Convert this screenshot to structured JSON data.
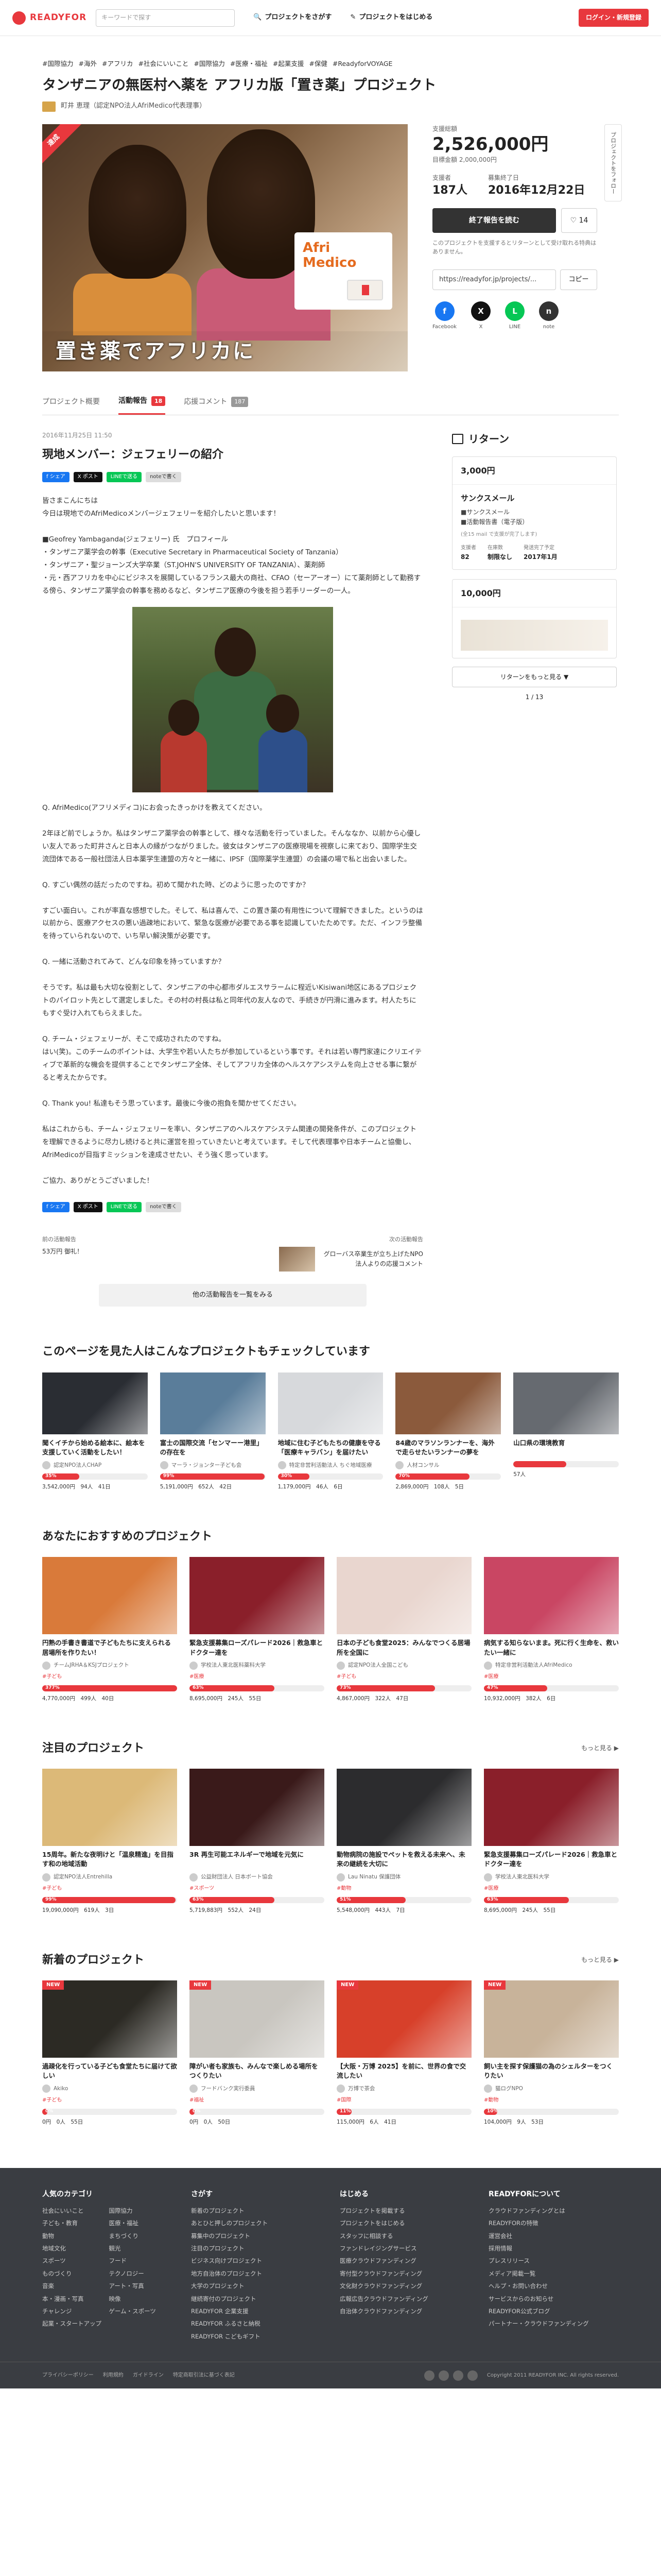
{
  "header": {
    "logo": "READYFOR",
    "search_placeholder": "キーワードで探す",
    "nav_search": "プロジェクトをさがす",
    "nav_start": "プロジェクトをはじめる",
    "login": "ログイン・新規登録"
  },
  "project": {
    "tags": [
      "#国際協力",
      "#海外",
      "#アフリカ",
      "#社会にいいこと",
      "#国際協力",
      "#医療・福祉",
      "#起業支援",
      "#保健",
      "#ReadyforVOYAGE"
    ],
    "title": "タンザニアの無医村へ薬を アフリカ版「置き薬」プロジェクト",
    "owner": "町井 恵理（認定NPO法人AfriMedico代表理事）",
    "hero_ribbon": "達成",
    "hero_brand_a": "Afri",
    "hero_brand_b": "Medico",
    "hero_caption": "置き薬でアフリカに"
  },
  "sidebar": {
    "total_label": "支援総額",
    "total_amount": "2,526,000円",
    "target": "目標金額 2,000,000円",
    "supporters_label": "支援者",
    "supporters": "187人",
    "end_label": "募集終了日",
    "end_date": "2016年12月22日",
    "report_button": "終了報告を読む",
    "favorite_count": "14",
    "note": "このプロジェクトを支援するとリターンとして受け取れる特典はありません。",
    "url": "https://readyfor.jp/projects/...",
    "copy": "コピー",
    "shares": [
      {
        "label": "Facebook",
        "glyph": "f",
        "color": "#1877f2"
      },
      {
        "label": "X",
        "glyph": "X",
        "color": "#111111"
      },
      {
        "label": "LINE",
        "glyph": "L",
        "color": "#06c755"
      },
      {
        "label": "note",
        "glyph": "n",
        "color": "#333333"
      }
    ],
    "follow": "プロジェクトをフォロー"
  },
  "tabs": [
    {
      "label": "プロジェクト概要",
      "badge": ""
    },
    {
      "label": "活動報告",
      "badge": "18"
    },
    {
      "label": "応援コメント",
      "badge": "187"
    }
  ],
  "article": {
    "date": "2016年11月25日 11:50",
    "title": "現地メンバー：ジェフェリーの紹介",
    "share_fb": "f シェア",
    "share_x": "X ポスト",
    "share_line": "LINEで送る",
    "share_note": "noteで書く",
    "body1": "皆さまこんにちは\n今日は現地でのAfriMedicoメンバージェフェリーを紹介したいと思います！\n\n■Geofrey Yambaganda(ジェフェリー) 氏　プロフィール\n・タンザニア薬学会の幹事（Executive Secretary in Pharmaceutical Society of Tanzania）\n・タンザニア・聖ジョーンズ大学卒業（ST.JOHN'S UNIVERSITY OF TANZANIA）、薬剤師\n・元・西アフリカを中心にビジネスを展開しているフランス最大の商社、CFAO（セーアーオー）にて薬剤師として勤務する傍ら、タンザニア薬学会の幹事を務めるなど、タンザニア医療の今後を担う若手リーダーの一人。",
    "body2": "Q. AfriMedico(アフリメディコ)にお会ったきっかけを教えてください。\n\n2年ほど前でしょうか。私はタンザニア薬学会の幹事として、様々な活動を行っていました。そんななか、以前から心優しい友人であった町井さんと日本人の縁がつながりました。彼女はタンザニアの医療現場を視察しに来ており、国際学生交流団体である一般社団法人日本薬学生連盟の方々と一緒に、IPSF（国際薬学生連盟）の会議の場で私と出会いました。\n\nQ. すごい偶然の話だったのですね。初めて聞かれた時、どのように思ったのですか？\n\nすごい面白い。これが率直な感想でした。そして、私は喜んで、この置き薬の有用性について理解できました。というのは以前から、医療アクセスの悪い過疎地において、緊急な医療が必要である事を認識していたためです。ただ、インフラ整備を待っていられないので、いち早い解決策が必要です。\n\nQ. 一緒に活動されてみて、どんな印象を持っていますか？\n\nそうです。私は最も大切な役割として、タンザニアの中心都市ダルエスサラームに程近いKisiwani地区にあるプロジェクトのパイロット先として選定しました。その村の村長は私と同年代の友人なので、手続きが円滑に進みます。村人たちにもすぐ受け入れてもらえました。\n\nQ. チーム・ジェフェリーが、そこで成功されたのですね。\nはい(笑)。このチームのポイントは、大学生や若い人たちが参加しているという事です。それは若い専門家達にクリエイティブで革新的な機会を提供することでタンザニア全体、そしてアフリカ全体のヘルスケアシステムを向上させる事に繋がると考えたからです。\n\nQ. Thank you! 私達もそう思っています。最後に今後の抱負を聞かせてください。\n\n私はこれからも、チーム・ジェフェリーを率い、タンザニアのヘルスケアシステム関連の開発条件が、このプロジェクトを理解できるように尽力し続けると共に運営を担っていきたいと考えています。そして代表理事や日本チームと協働し、AfriMedicoが目指すミッションを達成させたい、そう強く思っています。\n\nご協力、ありがとうございました！",
    "prev_label": "前の活動報告",
    "prev_title": "53万円 御礼！",
    "next_label": "次の活動報告",
    "next_title": "グローバス卒業生が立ち上げたNPO法人よりの応援コメント",
    "all_reports": "他の活動報告を一覧をみる"
  },
  "rewards": {
    "heading": "リターン",
    "card1_price": "3,000円",
    "card1_name": "サンクスメール",
    "card1_items": "■サンクスメール\n■活動報告書（電子版）",
    "card1_note": "(全15 mail で支援が完了します)",
    "card1_stats": [
      {
        "label": "支援者",
        "value": "82"
      },
      {
        "label": "在庫数",
        "value": "制限なし"
      },
      {
        "label": "発送完了予定",
        "value": "2017年1月"
      }
    ],
    "card2_price": "10,000円",
    "see_all": "リターンをもっと見る ▼",
    "pager": "1 ∕ 13"
  },
  "sections": [
    {
      "title": "このページを見た人はこんなプロジェクトもチェックしています",
      "more": "",
      "layout": "five",
      "cards": [
        {
          "title": "聞くイチから始める絵本に、絵本を支援していく活動をしたい！",
          "owner": "認定NPO法人CHAP",
          "tag": "",
          "pct": "35%",
          "fill": 0.35,
          "stats": "3,542,000円　94人　41日",
          "bg": "#2a2d33",
          "new": false
        },
        {
          "title": "富士の国際交流「センマーー港里」の存在を",
          "owner": "マーラ・ジョンター子ども会",
          "tag": "",
          "pct": "99%",
          "fill": 0.99,
          "stats": "5,191,000円　652人　42日",
          "bg": "#5a7d9a",
          "new": false
        },
        {
          "title": "地域に住む子どもたちの健康を守る「医療キャラバン」を届けたい",
          "owner": "特定非営利活動法人 ちぐ地域医療",
          "tag": "",
          "pct": "30%",
          "fill": 0.3,
          "stats": "1,179,000円　46人　6日",
          "bg": "#d7d9dc",
          "new": false
        },
        {
          "title": "84歳のマラソンランナーを、海外で走らせたいランナーの夢を",
          "owner": "人材コンサル",
          "tag": "",
          "pct": "70%",
          "fill": 0.7,
          "stats": "2,869,000円　108人　5日",
          "bg": "#8b5a3c",
          "new": false
        },
        {
          "title": "山口県の環境教育",
          "owner": "",
          "tag": "",
          "pct": "",
          "fill": 0.5,
          "stats": "57人",
          "bg": "#666a70",
          "new": false
        }
      ]
    },
    {
      "title": "あなたにおすすめのプロジェクト",
      "more": "",
      "layout": "four",
      "cards": [
        {
          "title": "円熟の手書き書道で子どもたちに支えられる居場所を作りたい！",
          "owner": "チームJRHA＆KSJプロジェクト",
          "tag": "#子ども",
          "pct": "377%",
          "fill": 1,
          "stats": "4,770,000円　499人　40日",
          "bg": "#d97a3a",
          "new": false
        },
        {
          "title": "緊急支援募集ローズパレード2026｜救急車とドクター達を",
          "owner": "学校法人東北医科薬科大学",
          "tag": "#医療",
          "pct": "63%",
          "fill": 0.63,
          "stats": "8,695,000円　245人　55日",
          "bg": "#8a1f2a",
          "new": false
        },
        {
          "title": "日本の子ども食堂2025：みんなでつくる居場所を全国に",
          "owner": "認定NPO法人全国こども",
          "tag": "#子ども",
          "pct": "73%",
          "fill": 0.73,
          "stats": "4,867,000円　322人　47日",
          "bg": "#e9d6cf",
          "new": false
        },
        {
          "title": "病気する知らないまま。死に行く生命を、救いたい一緒に",
          "owner": "特定非営利活動法人AfriMedico",
          "tag": "#医療",
          "pct": "47%",
          "fill": 0.47,
          "stats": "10,932,000円　382人　6日",
          "bg": "#c94663",
          "new": false
        }
      ]
    },
    {
      "title": "注目のプロジェクト",
      "more": "もっと見る ▶",
      "layout": "four",
      "cards": [
        {
          "title": "15周年。新たな夜明けと「温泉精進」を目指す和の地域活動",
          "owner": "認定NPO法人Entrehilla",
          "tag": "#子ども",
          "pct": "99%",
          "fill": 0.99,
          "stats": "19,090,000円　619人　3日",
          "bg": "#dcb978",
          "new": false
        },
        {
          "title": "3R 再生可能エネルギーで地域を元気に",
          "owner": "公益財団法人 日本ボート協会",
          "tag": "#スポーツ",
          "pct": "63%",
          "fill": 0.63,
          "stats": "5,719,883円　552人　24日",
          "bg": "#3a1a1a",
          "new": false
        },
        {
          "title": "動物病院の施設でペットを救える未来へ、未来の継続を大切に",
          "owner": "Lau Ninatu 保護団体",
          "tag": "#動物",
          "pct": "51%",
          "fill": 0.51,
          "stats": "5,548,000円　443人　7日",
          "bg": "#2c2c2e",
          "new": false
        },
        {
          "title": "緊急支援募集ローズパレード2026｜救急車とドクター達を",
          "owner": "学校法人東北医科大学",
          "tag": "#医療",
          "pct": "63%",
          "fill": 0.63,
          "stats": "8,695,000円　245人　55日",
          "bg": "#8a1f2a",
          "new": false
        }
      ]
    },
    {
      "title": "新着のプロジェクト",
      "more": "もっと見る ▶",
      "layout": "four",
      "cards": [
        {
          "title": "過疎化を行っている子ども食堂たちに届けて欲しい",
          "owner": "Akiko",
          "tag": "#子ども",
          "pct": "0%",
          "fill": 0.02,
          "stats": "0円　0人　55日",
          "bg": "#2c2a24",
          "new": true
        },
        {
          "title": "障がい者も家族も、みんなで楽しめる場所をつくりたい",
          "owner": "フードバンク実行委員",
          "tag": "#福祉",
          "pct": "0%",
          "fill": 0.02,
          "stats": "0円　0人　50日",
          "bg": "#c9c6c0",
          "new": true
        },
        {
          "title": "【大阪・万博 2025】を前に、世界の食で交流したい",
          "owner": "万博で茶会",
          "tag": "#国際",
          "pct": "11%",
          "fill": 0.11,
          "stats": "115,000円　6人　41日",
          "bg": "#d7402a",
          "new": true
        },
        {
          "title": "飼い主を探す保護猫の為のシェルターをつくりたい",
          "owner": "猫ログNPO",
          "tag": "#動物",
          "pct": "10%",
          "fill": 0.1,
          "stats": "104,000円　9人　53日",
          "bg": "#c8b39a",
          "new": true
        }
      ]
    }
  ],
  "footer": {
    "cols": [
      {
        "title": "人気のカテゴリ",
        "two": true,
        "links": [
          "社会にいいこと",
          "国際協力",
          "子ども・教育",
          "医療・福祉",
          "動物",
          "まちづくり",
          "地域文化",
          "観光",
          "スポーツ",
          "フード",
          "ものづくり",
          "テクノロジー",
          "音楽",
          "アート・写真",
          "本・漫画・写真",
          "映像",
          "チャレンジ",
          "ゲーム・スポーツ",
          "起業・スタートアップ"
        ]
      },
      {
        "title": "さがす",
        "two": false,
        "links": [
          "新着のプロジェクト",
          "あとひと押しのプロジェクト",
          "募集中のプロジェクト",
          "注目のプロジェクト",
          "ビジネス向けプロジェクト",
          "地方自治体のプロジェクト",
          "大学のプロジェクト",
          "継続寄付のプロジェクト",
          "READYFOR 企業支援",
          "READYFOR ふるさと納税",
          "READYFOR こどもギフト"
        ]
      },
      {
        "title": "はじめる",
        "two": false,
        "links": [
          "プロジェクトを掲載する",
          "プロジェクトをはじめる",
          "スタッフに相談する",
          "ファンドレイジングサービス",
          "医療クラウドファンディング",
          "寄付型クラウドファンディング",
          "文化財クラウドファンディング",
          "広報広告クラウドファンディング",
          "自治体クラウドファンディング"
        ]
      },
      {
        "title": "READYFORについて",
        "two": false,
        "links": [
          "クラウドファンディングとは",
          "READYFORの特徴",
          "運営会社",
          "採用情報",
          "プレスリリース",
          "メディア掲載一覧",
          "ヘルプ・お問い合わせ",
          "サービスからのお知らせ",
          "READYFOR公式ブログ",
          "パートナー・クラウドファンディング"
        ]
      }
    ],
    "bottom_links": [
      "プライバシーポリシー",
      "利用規約",
      "ガイドライン",
      "特定商取引法に基づく表記"
    ],
    "copyright": "Copyright 2011 READYFOR INC. All rights reserved."
  }
}
